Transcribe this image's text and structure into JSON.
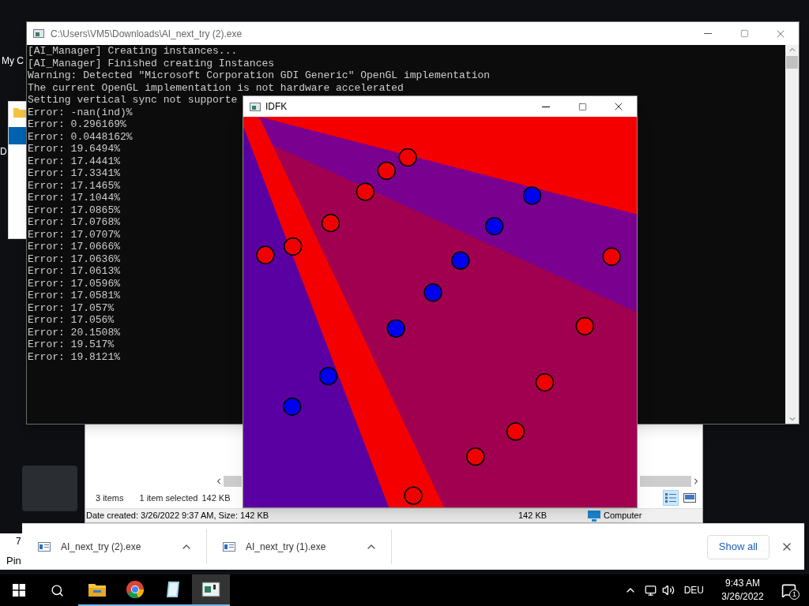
{
  "desktop": {
    "labels": [
      "My C",
      "D",
      "7",
      "Pin"
    ]
  },
  "explorer": {
    "item_count": "3 items",
    "selection": "1 item selected",
    "selection_size": "142 KB",
    "details": "Date created: 3/26/2022 9:37 AM, Size: 142 KB",
    "size": "142 KB",
    "location": "Computer",
    "views": [
      {
        "kind": "details",
        "selected": true
      },
      {
        "kind": "preview",
        "selected": false
      }
    ]
  },
  "console": {
    "title": "C:\\Users\\VM5\\Downloads\\AI_next_try (2).exe",
    "lines": [
      "[AI_Manager] Creating instances...",
      "[AI_Manager] Finished creating Instances",
      "Warning: Detected \"Microsoft Corporation GDI Generic\" OpenGL implementation",
      "The current OpenGL implementation is not hardware accelerated",
      "Setting vertical sync not supporte",
      "Error: -nan(ind)%",
      "Error: 0.296169%",
      "Error: 0.0448162%",
      "Error: 19.6494%",
      "Error: 17.4441%",
      "Error: 17.3341%",
      "Error: 17.1465%",
      "Error: 17.1044%",
      "Error: 17.0865%",
      "Error: 17.0768%",
      "Error: 17.0707%",
      "Error: 17.0666%",
      "Error: 17.0636%",
      "Error: 17.0613%",
      "Error: 17.0596%",
      "Error: 17.0581%",
      "Error: 17.057%",
      "Error: 17.056%",
      "Error: 20.1508%",
      "Error: 19.517%",
      "Error: 19.8121%"
    ]
  },
  "game_window": {
    "title": "IDFK"
  },
  "downloads": {
    "items": [
      {
        "name": "AI_next_try (2).exe"
      },
      {
        "name": "AI_next_try (1).exe"
      }
    ],
    "show_all": "Show all"
  },
  "taskbar": {
    "apps": [
      {
        "kind": "explorer",
        "selected": false
      },
      {
        "kind": "chrome",
        "selected": false
      },
      {
        "kind": "notepad",
        "selected": false
      },
      {
        "kind": "console",
        "selected": true
      }
    ],
    "language": "DEU",
    "time": "9:43 AM",
    "date": "3/26/2022",
    "notifications": "1"
  }
}
